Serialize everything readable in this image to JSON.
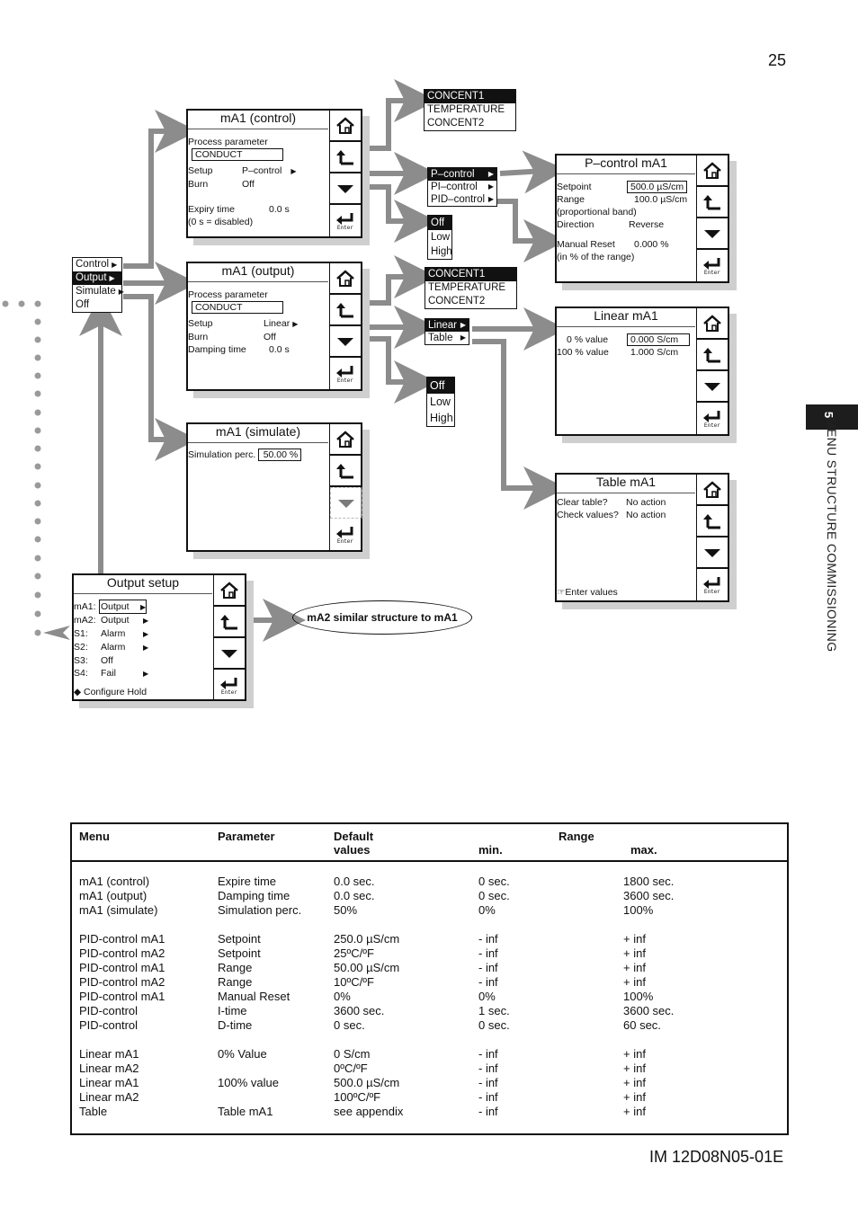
{
  "page": {
    "number": "25",
    "doc_id": "IM 12D08N05-01E",
    "section_number": "5",
    "section_title": "MENU STRUCTURE COMMISSIONING"
  },
  "icons": {
    "home": "home-icon",
    "back": "back-arrow-icon",
    "down": "down-arrow-icon",
    "enter": "enter-icon",
    "enter_label": "Enter"
  },
  "main_menu": {
    "items": [
      "Control",
      "Output",
      "Simulate",
      "Off"
    ],
    "selected": "Output"
  },
  "screens": {
    "control": {
      "title": "mA1 (control)",
      "process_label": "Process parameter",
      "process_value": "CONDUCT",
      "setup_label": "Setup",
      "setup_value": "P–control",
      "burn_label": "Burn",
      "burn_value": "Off",
      "expiry_label": "Expiry time",
      "expiry_value": "0.0 s",
      "expiry_note": "(0 s = disabled)"
    },
    "output": {
      "title": "mA1 (output)",
      "process_label": "Process parameter",
      "process_value": "CONDUCT",
      "setup_label": "Setup",
      "setup_value": "Linear",
      "burn_label": "Burn",
      "burn_value": "Off",
      "damping_label": "Damping time",
      "damping_value": "0.0 s"
    },
    "simulate": {
      "title": "mA1 (simulate)",
      "sim_label": "Simulation perc.",
      "sim_value": "50.00 %"
    },
    "pcontrol": {
      "title": "P–control mA1",
      "setpoint_label": "Setpoint",
      "setpoint_value": "500.0 µS/cm",
      "range_label": "Range",
      "range_value": "100.0 µS/cm",
      "range_note": "(proportional band)",
      "direction_label": "Direction",
      "direction_value": "Reverse",
      "reset_label": "Manual Reset",
      "reset_value": "0.000 %",
      "reset_note": "(in % of the range)"
    },
    "linear": {
      "title": "Linear mA1",
      "zero_label": "0 % value",
      "zero_value": "0.000 S/cm",
      "full_label": "100 % value",
      "full_value": "1.000 S/cm"
    },
    "table": {
      "title": "Table mA1",
      "clear_label": "Clear table?",
      "clear_value": "No action",
      "check_label": "Check values?",
      "check_value": "No action",
      "enter_values": "Enter values"
    },
    "output_setup": {
      "title": "Output setup",
      "rows": [
        {
          "label": "mA1:",
          "value": "Output",
          "arrow": true
        },
        {
          "label": "mA2:",
          "value": "Output",
          "arrow": true
        },
        {
          "label": "S1:",
          "value": "Alarm",
          "arrow": true
        },
        {
          "label": "S2:",
          "value": "Alarm",
          "arrow": true
        },
        {
          "label": "S3:",
          "value": "Off",
          "arrow": false
        },
        {
          "label": "S4:",
          "value": "Fail",
          "arrow": true
        }
      ],
      "configure_hold": "Configure Hold"
    }
  },
  "popups": {
    "param1": [
      "CONCENT1",
      "TEMPERATURE",
      "CONCENT2"
    ],
    "control_types": [
      "P–control",
      "PI–control",
      "PID–control"
    ],
    "burn1": [
      "Off",
      "Low",
      "High"
    ],
    "param2": [
      "CONCENT1",
      "TEMPERATURE",
      "CONCENT2"
    ],
    "output_types": [
      "Linear",
      "Table"
    ],
    "burn2": [
      "Off",
      "Low",
      "High"
    ]
  },
  "note": "mA2 similar structure to mA1",
  "table": {
    "headers": {
      "menu": "Menu",
      "parameter": "Parameter",
      "default1": "Default",
      "default2": "values",
      "range": "Range",
      "min": "min.",
      "max": "max."
    },
    "groups": [
      [
        [
          "mA1 (control)",
          "Expire time",
          "0.0 sec.",
          "0 sec.",
          "1800 sec."
        ],
        [
          "mA1 (output)",
          "Damping time",
          "0.0 sec.",
          "0 sec.",
          "3600 sec."
        ],
        [
          "mA1 (simulate)",
          "Simulation perc.",
          "50%",
          "0%",
          "100%"
        ]
      ],
      [
        [
          "PID-control mA1",
          "Setpoint",
          "250.0 µS/cm",
          "- inf",
          "+ inf"
        ],
        [
          "PID-control mA2",
          "Setpoint",
          "25ºC/ºF",
          "- inf",
          "+ inf"
        ],
        [
          "PID-control mA1",
          "Range",
          "50.00 µS/cm",
          "- inf",
          "+ inf"
        ],
        [
          "PID-control mA2",
          "Range",
          "10ºC/ºF",
          "- inf",
          "+ inf"
        ],
        [
          "PID-control mA1",
          "Manual Reset",
          "0%",
          "0%",
          "100%"
        ],
        [
          "PID-control",
          "I-time",
          "3600 sec.",
          "1 sec.",
          "3600 sec."
        ],
        [
          "PID-control",
          "D-time",
          "0 sec.",
          "0 sec.",
          "60 sec."
        ]
      ],
      [
        [
          "Linear mA1",
          "0% Value",
          "0 S/cm",
          "- inf",
          "+ inf"
        ],
        [
          "Linear mA2",
          "",
          "0ºC/ºF",
          "- inf",
          "+ inf"
        ],
        [
          "Linear mA1",
          "100% value",
          "500.0 µS/cm",
          "- inf",
          "+ inf"
        ],
        [
          "Linear mA2",
          "",
          "100ºC/ºF",
          "- inf",
          "+ inf"
        ],
        [
          "Table",
          "Table mA1",
          "see appendix",
          "- inf",
          "+ inf"
        ]
      ]
    ]
  }
}
